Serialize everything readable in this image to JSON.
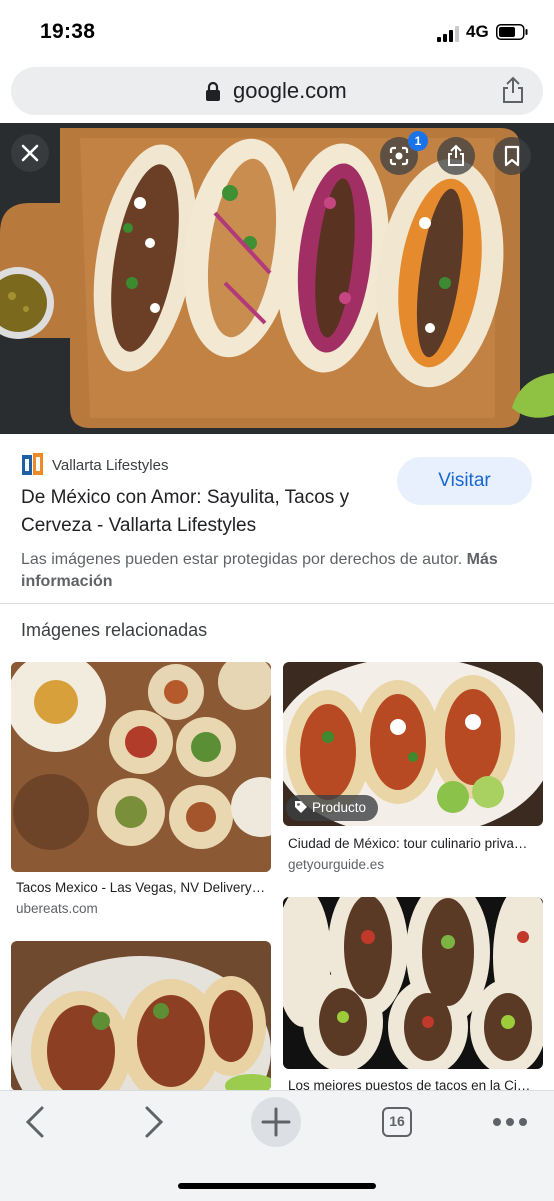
{
  "status_bar": {
    "time": "19:38",
    "network": "4G"
  },
  "address_bar": {
    "url": "google.com"
  },
  "viewer": {
    "lens_badge_count": "1",
    "source_name": "Vallarta Lifestyles",
    "title": "De México con Amor: Sayulita, Tacos y Cerveza - Vallarta Lifestyles",
    "visit_label": "Visitar",
    "copyright_text": "Las imágenes pueden estar protegidas por derechos de autor.",
    "more_info_label": "Más información"
  },
  "related": {
    "heading": "Imágenes relacionadas",
    "items": [
      {
        "caption": "Tacos Mexico - Las Vegas, NV Delivery…",
        "domain": "ubereats.com"
      },
      {
        "caption": "Ciudad de México: tour culinario priva…",
        "domain": "getyourguide.es",
        "chip": "Producto"
      },
      {
        "caption": "",
        "domain": ""
      },
      {
        "caption": "Los mejores puestos de tacos en la Ci…",
        "domain": ""
      }
    ]
  },
  "toolbar": {
    "tab_count": "16"
  },
  "colors": {
    "accent": "#1a73e8",
    "visit_bg": "#e8f0fe",
    "visit_text": "#1967d2"
  }
}
